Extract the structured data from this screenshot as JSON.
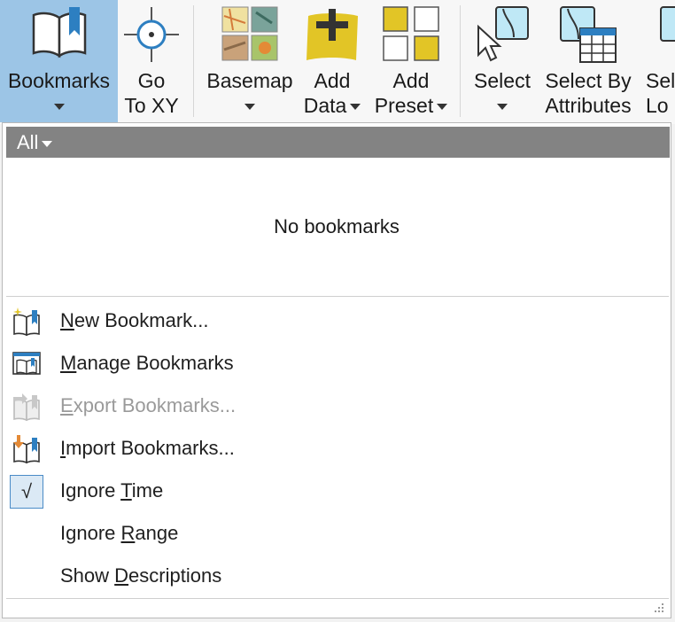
{
  "ribbon": {
    "bookmarks": {
      "line1": "Bookmarks"
    },
    "goto": {
      "line1": "Go",
      "line2": "To XY"
    },
    "basemap": {
      "line1": "Basemap"
    },
    "add_data": {
      "line1": "Add",
      "line2": "Data"
    },
    "add_preset": {
      "line1": "Add",
      "line2": "Preset"
    },
    "select": {
      "line1": "Select"
    },
    "select_by_attr": {
      "line1": "Select By",
      "line2": "Attributes"
    },
    "select_by_loc": {
      "line1": "Sele",
      "line2": "Lo"
    }
  },
  "panel": {
    "filter": "All",
    "empty_message": "No bookmarks",
    "menu": [
      {
        "pre": "",
        "key": "N",
        "post": "ew Bookmark...",
        "enabled": true,
        "icon": "new-bookmark-icon"
      },
      {
        "pre": "",
        "key": "M",
        "post": "anage Bookmarks",
        "enabled": true,
        "icon": "manage-bookmarks-icon"
      },
      {
        "pre": "",
        "key": "E",
        "post": "xport Bookmarks...",
        "enabled": false,
        "icon": "export-bookmarks-icon"
      },
      {
        "pre": "",
        "key": "I",
        "post": "mport Bookmarks...",
        "enabled": true,
        "icon": "import-bookmarks-icon"
      },
      {
        "pre": "Ignore ",
        "key": "T",
        "post": "ime",
        "checked": true,
        "check_mark": "√"
      },
      {
        "pre": "Ignore ",
        "key": "R",
        "post": "ange",
        "checked": false
      },
      {
        "pre": "Show ",
        "key": "D",
        "post": "escriptions",
        "checked": false
      }
    ]
  },
  "colors": {
    "active_button": "#9cc5e6",
    "filter_bar": "#838383",
    "accent_yellow": "#e2c526"
  }
}
